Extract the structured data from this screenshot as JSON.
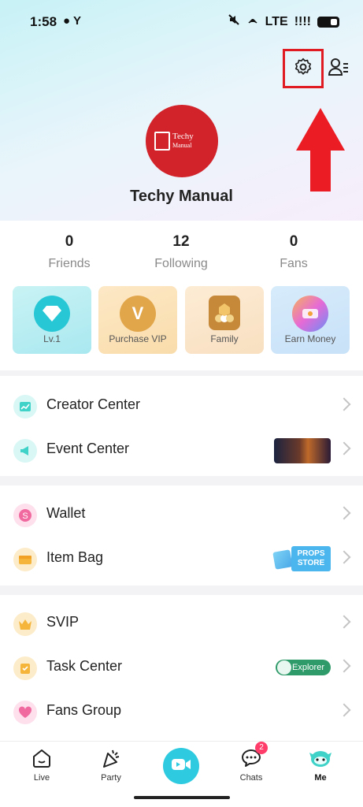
{
  "status_bar": {
    "time": "1:58",
    "left_icons": "● Y",
    "network": "LTE",
    "signal": "!!!!"
  },
  "profile": {
    "username": "Techy Manual",
    "avatar_text_main": "Techy",
    "avatar_text_sub": "Manual"
  },
  "stats": [
    {
      "value": "0",
      "label": "Friends"
    },
    {
      "value": "12",
      "label": "Following"
    },
    {
      "value": "0",
      "label": "Fans"
    }
  ],
  "cards": [
    {
      "label": "Lv.1",
      "icon": "diamond-icon"
    },
    {
      "label": "Purchase VIP",
      "icon": "vip-coin-icon",
      "icon_text": "V"
    },
    {
      "label": "Family",
      "icon": "family-badge-icon"
    },
    {
      "label": "Earn Money",
      "icon": "money-icon"
    }
  ],
  "menu_sections": [
    [
      {
        "label": "Creator Center",
        "icon": "creator-chart-icon",
        "color": "#3fd2c9"
      },
      {
        "label": "Event Center",
        "icon": "megaphone-icon",
        "color": "#3fd2c9"
      }
    ],
    [
      {
        "label": "Wallet",
        "icon": "wallet-coin-icon",
        "color": "#f06aa0"
      },
      {
        "label": "Item Bag",
        "icon": "bag-icon",
        "color": "#f5b43a"
      }
    ],
    [
      {
        "label": "SVIP",
        "icon": "crown-icon",
        "color": "#f5b43a"
      },
      {
        "label": "Task Center",
        "icon": "task-icon",
        "color": "#f5b43a"
      },
      {
        "label": "Fans Group",
        "icon": "heart-icon",
        "color": "#f06aa0"
      }
    ]
  ],
  "badges": {
    "props_line1": "PROPS",
    "props_line2": "STORE",
    "explorer": "Explorer"
  },
  "tabbar": {
    "tabs": [
      {
        "label": "Live",
        "icon": "home-face-icon"
      },
      {
        "label": "Party",
        "icon": "party-icon"
      },
      {
        "label": "",
        "icon": "go-live-camera-icon"
      },
      {
        "label": "Chats",
        "icon": "chat-bubble-icon",
        "badge": "2"
      },
      {
        "label": "Me",
        "icon": "me-avatar-icon"
      }
    ]
  },
  "colors": {
    "accent": "#2ecbe0",
    "highlight_box": "#e11b22",
    "avatar_bg": "#d2232a"
  }
}
